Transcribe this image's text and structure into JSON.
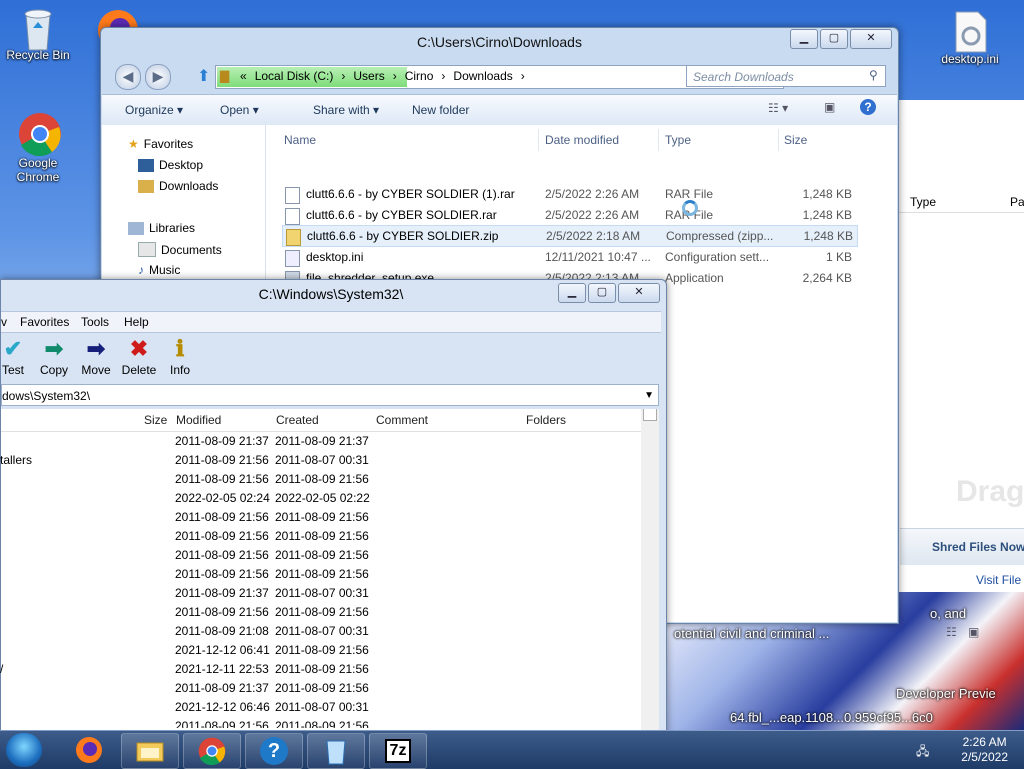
{
  "desktop": {
    "icons": [
      {
        "label": "Recycle Bin"
      },
      {
        "label": "Google Chrome"
      },
      {
        "label": "desktop.ini"
      }
    ]
  },
  "explorer": {
    "title": "C:\\Users\\Cirno\\Downloads",
    "breadcrumb": [
      "«",
      "Local Disk (C:)",
      "›",
      "Users",
      "›",
      "Cirno",
      "›",
      "Downloads",
      "›"
    ],
    "search_placeholder": "Search Downloads",
    "commands": {
      "organize": "Organize ▾",
      "open": "Open ▾",
      "share": "Share with ▾",
      "new_folder": "New folder"
    },
    "nav": {
      "favorites": "Favorites",
      "desktop": "Desktop",
      "downloads": "Downloads",
      "libraries": "Libraries",
      "documents": "Documents",
      "music": "Music"
    },
    "columns": {
      "name": "Name",
      "date": "Date modified",
      "type": "Type",
      "size": "Size"
    },
    "files": [
      {
        "name": "clutt6.6.6 - by CYBER SOLDIER (1).rar",
        "date": "2/5/2022 2:26 AM",
        "type": "RAR File",
        "size": "1,248 KB"
      },
      {
        "name": "clutt6.6.6 - by CYBER SOLDIER.rar",
        "date": "2/5/2022 2:26 AM",
        "type": "RAR File",
        "size": "1,248 KB"
      },
      {
        "name": "clutt6.6.6 - by CYBER SOLDIER.zip",
        "date": "2/5/2022 2:18 AM",
        "type": "Compressed (zipp...",
        "size": "1,248 KB"
      },
      {
        "name": "desktop.ini",
        "date": "12/11/2021 10:47 ...",
        "type": "Configuration sett...",
        "size": "1 KB"
      },
      {
        "name": "file_shredder_setup.exe",
        "date": "2/5/2022 2:13 AM",
        "type": "Application",
        "size": "2,264 KB"
      }
    ]
  },
  "right_app": {
    "col_type": "Type",
    "col_pa": "Pa",
    "drag_text": "Drag a",
    "shred_button": "Shred Files Now...",
    "visit_link": "Visit File S"
  },
  "sevenzip": {
    "title": "C:\\Windows\\System32\\",
    "menu": [
      "v",
      "Favorites",
      "Tools",
      "Help"
    ],
    "toolbar": [
      {
        "label": "Test",
        "icon": "test-icon"
      },
      {
        "label": "Copy",
        "icon": "copy-icon"
      },
      {
        "label": "Move",
        "icon": "move-icon"
      },
      {
        "label": "Delete",
        "icon": "delete-icon"
      },
      {
        "label": "Info",
        "icon": "info-icon"
      }
    ],
    "path": "dows\\System32\\",
    "columns": {
      "size": "Size",
      "modified": "Modified",
      "created": "Created",
      "comment": "Comment",
      "folders": "Folders"
    },
    "rows": [
      {
        "name": "",
        "modified": "2011-08-09 21:37",
        "created": "2011-08-09 21:37"
      },
      {
        "name": "tallers",
        "modified": "2011-08-09 21:56",
        "created": "2011-08-07 00:31"
      },
      {
        "name": "",
        "modified": "2011-08-09 21:56",
        "created": "2011-08-09 21:56"
      },
      {
        "name": "",
        "modified": "2022-02-05 02:24",
        "created": "2022-02-05 02:22"
      },
      {
        "name": "",
        "modified": "2011-08-09 21:56",
        "created": "2011-08-09 21:56"
      },
      {
        "name": "",
        "modified": "2011-08-09 21:56",
        "created": "2011-08-09 21:56"
      },
      {
        "name": "",
        "modified": "2011-08-09 21:56",
        "created": "2011-08-09 21:56"
      },
      {
        "name": "",
        "modified": "2011-08-09 21:56",
        "created": "2011-08-09 21:56"
      },
      {
        "name": "",
        "modified": "2011-08-09 21:37",
        "created": "2011-08-07 00:31"
      },
      {
        "name": "",
        "modified": "2011-08-09 21:56",
        "created": "2011-08-09 21:56"
      },
      {
        "name": "",
        "modified": "2011-08-09 21:08",
        "created": "2011-08-07 00:31"
      },
      {
        "name": "",
        "modified": "2021-12-12 06:41",
        "created": "2011-08-09 21:56"
      },
      {
        "name": "/",
        "modified": "2021-12-11 22:53",
        "created": "2011-08-09 21:56"
      },
      {
        "name": "",
        "modified": "2011-08-09 21:37",
        "created": "2011-08-09 21:56"
      },
      {
        "name": "",
        "modified": "2021-12-12 06:46",
        "created": "2011-08-07 00:31"
      },
      {
        "name": "",
        "modified": "2011-08-09 21:56",
        "created": "2011-08-09 21:56"
      }
    ]
  },
  "background_text": {
    "line1": "o, and",
    "line2": "otential civil and criminal ...",
    "line3": "Developer Previe",
    "line4": "64.fbl_...eap.1108...0.959cf95...6c0"
  },
  "taskbar": {
    "apps": [
      "firefox-icon",
      "explorer-icon",
      "chrome-icon",
      "help-icon",
      "recycle-icon",
      "7zip-icon"
    ],
    "sevenzip_label": "7z",
    "time": "2:26 AM",
    "date": "2/5/2022"
  }
}
